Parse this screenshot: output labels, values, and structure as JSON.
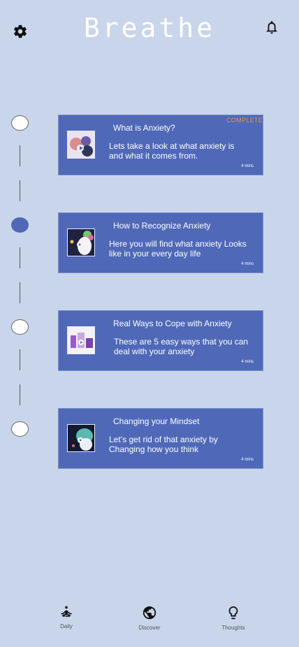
{
  "app": {
    "title": "Breathe"
  },
  "header": {
    "settings_icon": "gear-icon",
    "notifications_icon": "bell-icon"
  },
  "lessons": [
    {
      "title": "What is Anxiety?",
      "description": "Lets take a look at what anxiety is and what it comes from.",
      "duration": "4 mins",
      "status": "COMPLETE",
      "node_state": "empty"
    },
    {
      "title": "How to Recognize Anxiety",
      "description": "Here you will find what anxiety Looks like in your every day life",
      "duration": "4 mins",
      "status": "",
      "node_state": "filled"
    },
    {
      "title": "Real Ways to Cope with Anxiety",
      "description": "These are 5 easy ways that you can deal with your anxiety",
      "duration": "4 mins",
      "status": "",
      "node_state": "empty"
    },
    {
      "title": "Changing your Mindset",
      "description": "Let’s get rid of that anxiety by Changing how you think",
      "duration": "4 mins",
      "status": "",
      "node_state": "empty"
    }
  ],
  "tabs": [
    {
      "label": "Daily",
      "icon": "meditation-icon"
    },
    {
      "label": "Discover",
      "icon": "globe-icon"
    },
    {
      "label": "Thoughts",
      "icon": "lightbulb-icon"
    }
  ],
  "colors": {
    "background": "#c9d5ea",
    "card": "#4f69b8",
    "status": "#e2944b",
    "node_filled": "#4f69b8"
  }
}
